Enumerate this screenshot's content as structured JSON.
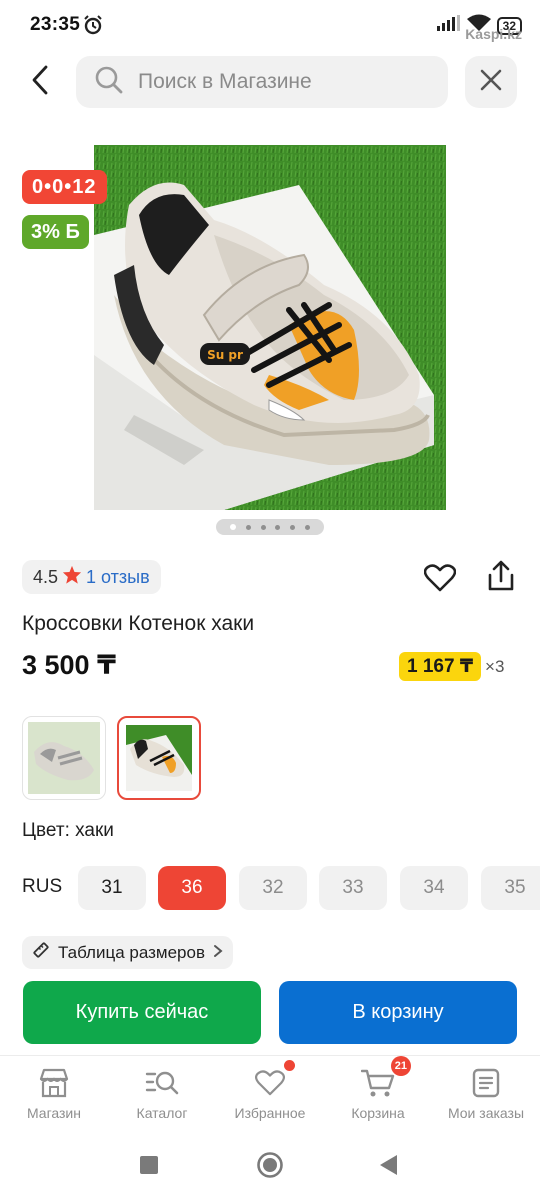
{
  "status_bar": {
    "time": "23:35",
    "battery": "32",
    "watermark": "Kaspi.kz"
  },
  "header": {
    "search_placeholder": "Поиск в Магазине"
  },
  "gallery": {
    "timer_badge": "0•0•12",
    "bonus_badge": "3% Б",
    "page_count": 6,
    "active_index": 0,
    "print": "Su pr"
  },
  "product": {
    "rating": "4.5",
    "reviews": "1 отзыв",
    "title": "Кроссовки Котенок хаки",
    "price": "3 500 ₸",
    "installment_amount": "1 167 ₸",
    "installment_multiplier": "×3",
    "color_label": "Цвет: хаки",
    "size_system": "RUS",
    "sizes": [
      {
        "label": "31",
        "state": "available"
      },
      {
        "label": "36",
        "state": "selected"
      },
      {
        "label": "32",
        "state": "unavailable"
      },
      {
        "label": "33",
        "state": "unavailable"
      },
      {
        "label": "34",
        "state": "unavailable"
      },
      {
        "label": "35",
        "state": "unavailable"
      }
    ],
    "size_table": "Таблица размеров"
  },
  "actions": {
    "buy_now": "Купить сейчас",
    "add_to_cart": "В корзину"
  },
  "bottom_nav": {
    "items": [
      {
        "label": "Магазин",
        "icon": "shop-icon"
      },
      {
        "label": "Каталог",
        "icon": "catalog-search-icon"
      },
      {
        "label": "Избранное",
        "icon": "heart-icon"
      },
      {
        "label": "Корзина",
        "icon": "cart-icon",
        "badge": "21"
      },
      {
        "label": "Мои заказы",
        "icon": "orders-icon"
      }
    ]
  },
  "colors": {
    "buy_green": "#0fa84b",
    "cart_blue": "#0a6fd1",
    "accent_red": "#ee4535",
    "bonus_green": "#5fa82a",
    "installment_yellow": "#fbd50d"
  }
}
